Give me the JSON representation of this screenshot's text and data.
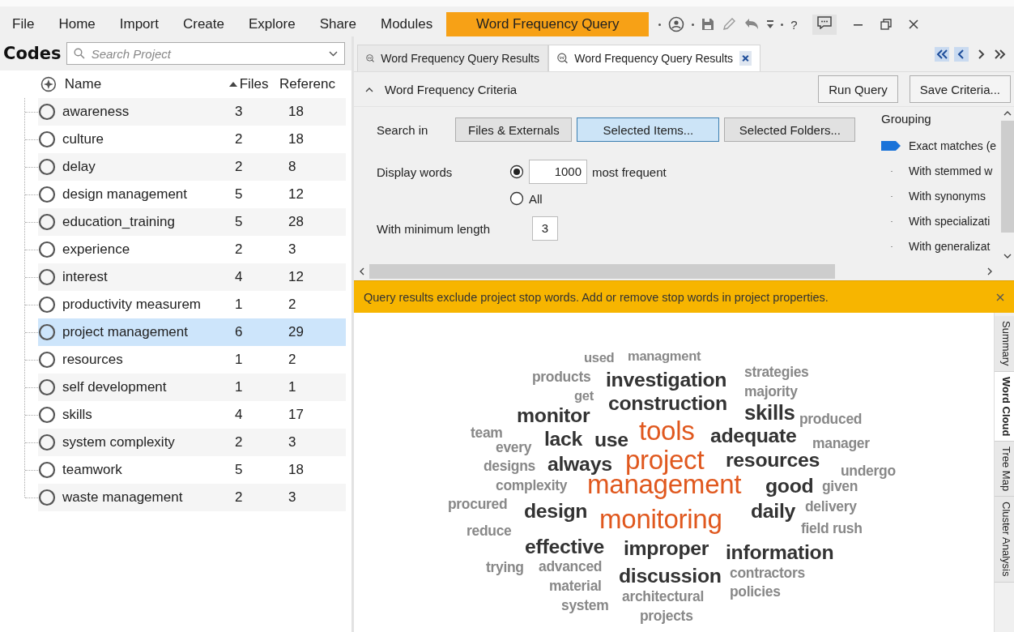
{
  "menu": [
    {
      "label": "File",
      "selected": false
    },
    {
      "label": "Home",
      "selected": false
    },
    {
      "label": "Import",
      "selected": false
    },
    {
      "label": "Create",
      "selected": false
    },
    {
      "label": "Explore",
      "selected": false
    },
    {
      "label": "Share",
      "selected": false
    },
    {
      "label": "Modules",
      "selected": false
    },
    {
      "label": "Word Frequency Query",
      "selected": true
    }
  ],
  "toolbar": {
    "help": "?"
  },
  "codes": {
    "title": "Codes",
    "search": {
      "placeholder": "Search Project"
    },
    "columns": [
      "Name",
      "Files",
      "Referenc"
    ],
    "rows": [
      {
        "name": "awareness",
        "files": "3",
        "references": "18",
        "selected": false
      },
      {
        "name": "culture",
        "files": "2",
        "references": "18",
        "selected": false
      },
      {
        "name": "delay",
        "files": "2",
        "references": "8",
        "selected": false
      },
      {
        "name": "design management",
        "files": "5",
        "references": "12",
        "selected": false
      },
      {
        "name": "education_training",
        "files": "5",
        "references": "28",
        "selected": false
      },
      {
        "name": "experience",
        "files": "2",
        "references": "3",
        "selected": false
      },
      {
        "name": "interest",
        "files": "4",
        "references": "12",
        "selected": false
      },
      {
        "name": "productivity measurem",
        "files": "1",
        "references": "2",
        "selected": false
      },
      {
        "name": "project management",
        "files": "6",
        "references": "29",
        "selected": true
      },
      {
        "name": "resources",
        "files": "1",
        "references": "2",
        "selected": false
      },
      {
        "name": "self development",
        "files": "1",
        "references": "1",
        "selected": false
      },
      {
        "name": "skills",
        "files": "4",
        "references": "17",
        "selected": false
      },
      {
        "name": "system complexity",
        "files": "2",
        "references": "3",
        "selected": false
      },
      {
        "name": "teamwork",
        "files": "5",
        "references": "18",
        "selected": false
      },
      {
        "name": "waste management",
        "files": "2",
        "references": "3",
        "selected": false
      }
    ]
  },
  "result_tabs": [
    {
      "label": "Word Frequency Query Results",
      "selected": false
    },
    {
      "label": "Word Frequency Query Results",
      "selected": true
    }
  ],
  "criteria": {
    "title": "Word Frequency Criteria",
    "expanded": true,
    "buttons": [
      "Run Query",
      "Save Criteria..."
    ],
    "search_in": {
      "label": "Search in",
      "options": [
        {
          "label": "Files & Externals",
          "selected": false
        },
        {
          "label": "Selected Items...",
          "selected": true
        },
        {
          "label": "Selected Folders...",
          "selected": false
        }
      ]
    },
    "display_words": {
      "label": "Display words",
      "options": [
        {
          "kind": "count",
          "value": "1000",
          "suffix": "most frequent",
          "selected": true
        },
        {
          "kind": "all",
          "label": "All",
          "selected": false
        }
      ]
    },
    "min_length": {
      "label": "With minimum length",
      "value": "3"
    },
    "grouping": {
      "title": "Grouping",
      "options": [
        {
          "label": "Exact matches (e",
          "selected": true
        },
        {
          "label": "With stemmed w",
          "selected": false
        },
        {
          "label": "With synonyms",
          "selected": false
        },
        {
          "label": "With specializati",
          "selected": false
        },
        {
          "label": "With generalizat",
          "selected": false
        }
      ]
    }
  },
  "banner": {
    "text": "Query results exclude project stop words. Add or remove stop words in project properties."
  },
  "word_cloud": {
    "words": [
      {
        "text": "used",
        "kind": "rare"
      },
      {
        "text": "managment",
        "kind": "rare"
      },
      {
        "text": "products",
        "kind": "rare"
      },
      {
        "text": "investigation",
        "kind": "frequent"
      },
      {
        "text": "strategies",
        "kind": "rare"
      },
      {
        "text": "get",
        "kind": "rare"
      },
      {
        "text": "majority",
        "kind": "rare"
      },
      {
        "text": "construction",
        "kind": "frequent"
      },
      {
        "text": "monitor",
        "kind": "frequent"
      },
      {
        "text": "skills",
        "kind": "frequent"
      },
      {
        "text": "produced",
        "kind": "rare"
      },
      {
        "text": "team",
        "kind": "rare"
      },
      {
        "text": "lack",
        "kind": "frequent"
      },
      {
        "text": "use",
        "kind": "frequent"
      },
      {
        "text": "tools",
        "kind": "top"
      },
      {
        "text": "adequate",
        "kind": "frequent"
      },
      {
        "text": "every",
        "kind": "rare"
      },
      {
        "text": "manager",
        "kind": "rare"
      },
      {
        "text": "designs",
        "kind": "rare"
      },
      {
        "text": "always",
        "kind": "frequent"
      },
      {
        "text": "project",
        "kind": "top"
      },
      {
        "text": "resources",
        "kind": "frequent"
      },
      {
        "text": "undergo",
        "kind": "rare"
      },
      {
        "text": "complexity",
        "kind": "rare"
      },
      {
        "text": "management",
        "kind": "top"
      },
      {
        "text": "good",
        "kind": "frequent"
      },
      {
        "text": "given",
        "kind": "rare"
      },
      {
        "text": "procured",
        "kind": "rare"
      },
      {
        "text": "design",
        "kind": "frequent"
      },
      {
        "text": "daily",
        "kind": "frequent"
      },
      {
        "text": "delivery",
        "kind": "rare"
      },
      {
        "text": "reduce",
        "kind": "rare"
      },
      {
        "text": "monitoring",
        "kind": "top"
      },
      {
        "text": "field rush",
        "kind": "rare"
      },
      {
        "text": "effective",
        "kind": "frequent"
      },
      {
        "text": "improper",
        "kind": "frequent"
      },
      {
        "text": "information",
        "kind": "frequent"
      },
      {
        "text": "trying",
        "kind": "rare"
      },
      {
        "text": "advanced",
        "kind": "rare"
      },
      {
        "text": "discussion",
        "kind": "frequent"
      },
      {
        "text": "contractors",
        "kind": "rare"
      },
      {
        "text": "material",
        "kind": "rare"
      },
      {
        "text": "policies",
        "kind": "rare"
      },
      {
        "text": "system",
        "kind": "rare"
      },
      {
        "text": "architectural",
        "kind": "rare"
      },
      {
        "text": "projects",
        "kind": "rare"
      }
    ]
  },
  "view_tabs": [
    {
      "label": "Summary",
      "selected": false
    },
    {
      "label": "Word Cloud",
      "selected": true
    },
    {
      "label": "Tree Map",
      "selected": false
    },
    {
      "label": "Cluster Analysis",
      "selected": false
    }
  ]
}
